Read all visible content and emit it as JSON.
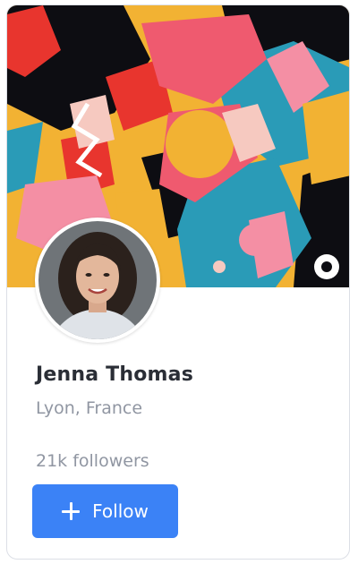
{
  "profile": {
    "name": "Jenna Thomas",
    "location": "Lyon, France",
    "followers": "21k followers"
  },
  "actions": {
    "follow_label": "Follow",
    "follow_icon": "plus-icon"
  },
  "colors": {
    "button": "#3b82f6",
    "name_text": "#2a2e36",
    "muted_text": "#9096a2",
    "cover_palette": [
      "#f2b233",
      "#ef5a6f",
      "#2a9bb7",
      "#0d0d12",
      "#f48fa4",
      "#f6c9c0"
    ]
  },
  "images": {
    "cover": "abstract colorful collage artwork",
    "avatar": "profile photo of smiling woman"
  }
}
